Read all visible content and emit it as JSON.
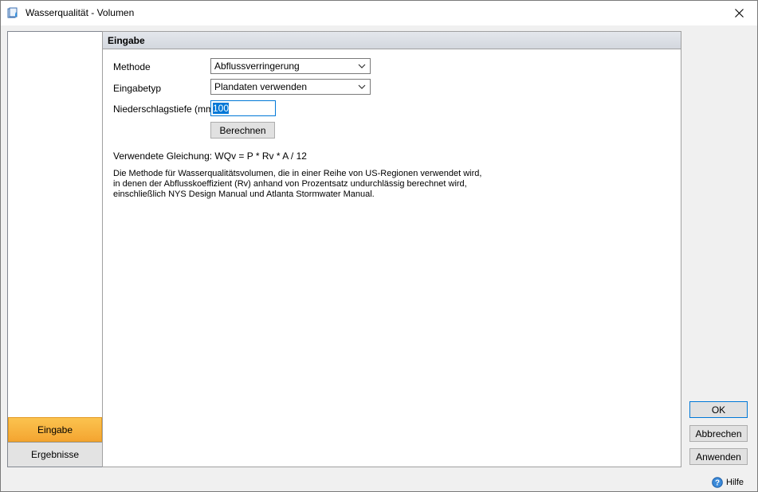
{
  "window": {
    "title": "Wasserqualität - Volumen",
    "app_icon": "water-quality-icon",
    "close_icon": "close-icon"
  },
  "sidebar": {
    "items": [
      {
        "label": "Eingabe",
        "active": true
      },
      {
        "label": "Ergebnisse",
        "active": false
      }
    ]
  },
  "panel": {
    "header": "Eingabe",
    "methode_label": "Methode",
    "methode_value": "Abflussverringerung",
    "eingabetyp_label": "Eingabetyp",
    "eingabetyp_value": "Plandaten verwenden",
    "niederschlag_label": "Niederschlagstiefe (mm)",
    "niederschlag_value": "100",
    "calc_button": "Berechnen",
    "equation": "Verwendete Gleichung: WQv = P * Rv * A / 12",
    "description": "Die Methode für Wasserqualitätsvolumen, die in einer Reihe von US-Regionen verwendet wird, in denen der Abflusskoeffizient (Rv) anhand von Prozentsatz undurchlässig berechnet wird, einschließlich NYS Design Manual und Atlanta Stormwater Manual."
  },
  "buttons": {
    "ok": "OK",
    "cancel": "Abbrechen",
    "apply": "Anwenden"
  },
  "help": {
    "label": "Hilfe",
    "icon": "help-icon"
  },
  "colors": {
    "accent": "#0078d7",
    "active_tab": "#f4a531"
  }
}
